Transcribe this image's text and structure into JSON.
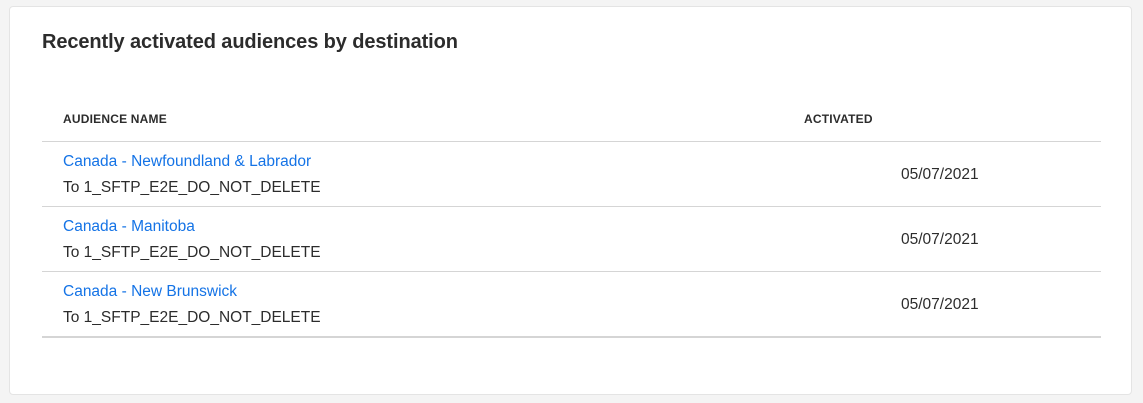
{
  "card": {
    "title": "Recently activated audiences by destination"
  },
  "table": {
    "columns": {
      "name": "AUDIENCE NAME",
      "activated": "ACTIVATED"
    },
    "rows": [
      {
        "name": "Canada - Newfoundland & Labrador",
        "destination": "To 1_SFTP_E2E_DO_NOT_DELETE",
        "activated": "05/07/2021"
      },
      {
        "name": "Canada - Manitoba",
        "destination": "To 1_SFTP_E2E_DO_NOT_DELETE",
        "activated": "05/07/2021"
      },
      {
        "name": "Canada - New Brunswick",
        "destination": "To 1_SFTP_E2E_DO_NOT_DELETE",
        "activated": "05/07/2021"
      }
    ]
  },
  "colors": {
    "link": "#1473e6",
    "text": "#2c2c2c",
    "divider": "#d5d5d5",
    "background": "#f4f4f4",
    "card": "#ffffff"
  }
}
